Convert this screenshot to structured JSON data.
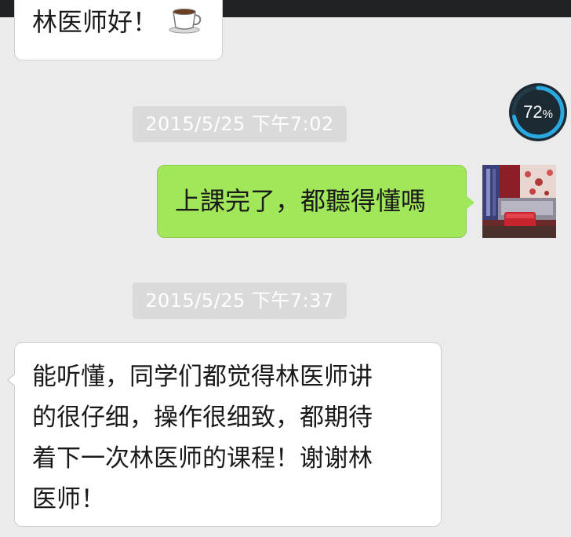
{
  "chat": {
    "messages": [
      {
        "side": "left",
        "text": "林医师好！",
        "icon": "coffee-cup-icon"
      },
      {
        "type": "timestamp",
        "text": "2015/5/25 下午7:02"
      },
      {
        "side": "right",
        "text": "上課完了，都聽得懂嗎",
        "avatar": "avatar-image"
      },
      {
        "type": "timestamp",
        "text": "2015/5/25 下午7:37"
      },
      {
        "side": "left",
        "text": "能听懂，同学们都觉得林医师讲\n的很仔细，操作很细致，都期待\n着下一次林医师的课程！谢谢林\n医师！"
      }
    ]
  },
  "overlay": {
    "progress_value": 72,
    "progress_number": "72",
    "progress_unit": "%"
  },
  "colors": {
    "background": "#ebebeb",
    "sent_bubble": "#a0e75a",
    "received_bubble": "#ffffff",
    "timestamp_bg": "#dadada",
    "progress_ring": "#2aa9e0"
  }
}
